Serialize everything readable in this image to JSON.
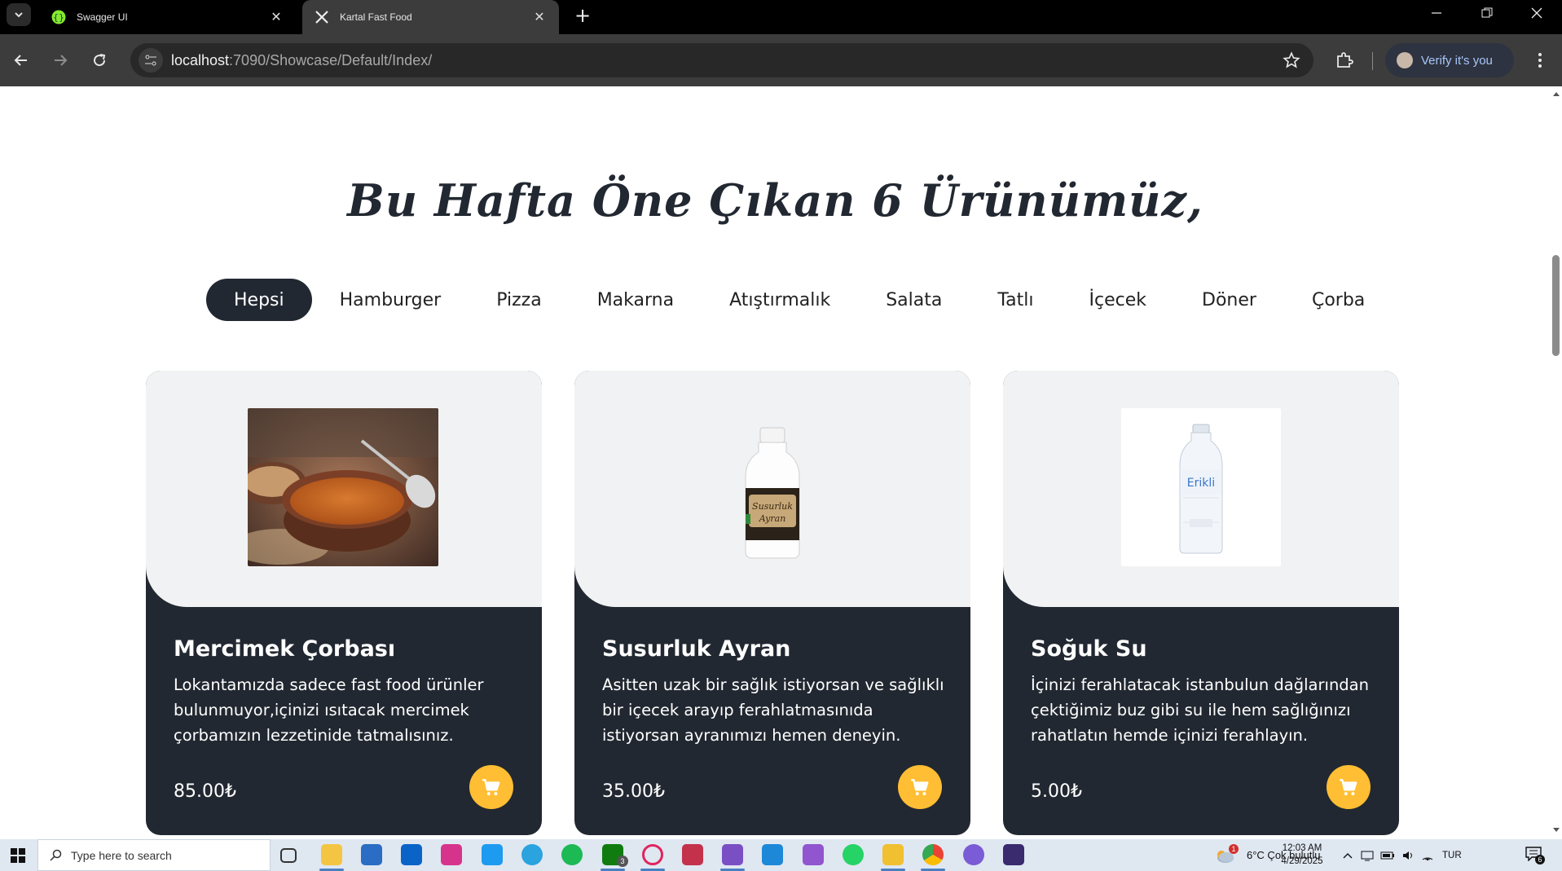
{
  "browser": {
    "tabs": [
      {
        "title": "Swagger UI",
        "icon": "swagger-icon"
      },
      {
        "title": "Kartal Fast Food",
        "icon": "fork-knife-icon"
      }
    ],
    "url_host": "localhost",
    "url_path": ":7090/Showcase/Default/Index/",
    "verify_label": "Verify it's you"
  },
  "page": {
    "heading": "Bu Hafta Öne Çıkan 6 Ürünümüz,",
    "filters": [
      "Hepsi",
      "Hamburger",
      "Pizza",
      "Makarna",
      "Atıştırmalık",
      "Salata",
      "Tatlı",
      "İçecek",
      "Döner",
      "Çorba"
    ],
    "active_filter": "Hepsi",
    "products": [
      {
        "name": "Mercimek Çorbası",
        "description": "Lokantamızda sadece fast food ürünler bulunmuyor,içinizi ısıtacak mercimek çorbamızın lezzetinide tatmalısınız.",
        "price": "85.00₺",
        "image": "lentil-soup-photo"
      },
      {
        "name": "Susurluk Ayran",
        "description": "Asitten uzak bir sağlık istiyorsan ve sağlıklı bir içecek arayıp ferahlatmasınıda istiyorsan ayranımızı hemen deneyin.",
        "price": "35.00₺",
        "image": "ayran-bottle-photo",
        "label_line1": "Susurluk",
        "label_line2": "Ayran"
      },
      {
        "name": "Soğuk Su",
        "description": "İçinizi ferahlatacak istanbulun dağlarından çektiğimiz buz gibi su ile hem sağlığınızı rahatlatın hemde içinizi ferahlayın.",
        "price": "5.00₺",
        "image": "water-bottle-photo",
        "label": "Erikli"
      }
    ]
  },
  "taskbar": {
    "search_placeholder": "Type here to search",
    "weather": "6°C  Çok bulutlu",
    "language": "TUR",
    "time": "12:03 AM",
    "date": "4/29/2025",
    "notification_count": "6",
    "xbox_badge": "3",
    "weather_badge": "1"
  },
  "colors": {
    "accent": "#ffbe33",
    "card_dark": "#222831",
    "card_light": "#f1f2f3"
  }
}
